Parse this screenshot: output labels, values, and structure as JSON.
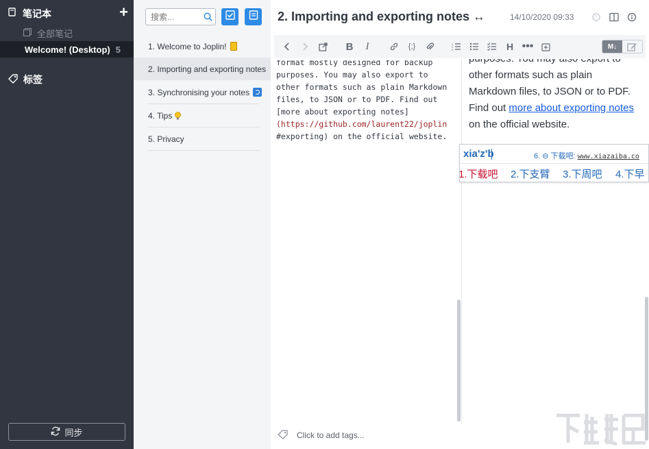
{
  "sidebar": {
    "notebooks_label": "笔记本",
    "add_label": "+",
    "all_notes_label": "全部笔记",
    "active_notebook": {
      "name": "Welcome! (Desktop)",
      "count": "5"
    },
    "tags_label": "标签",
    "sync_label": "同步"
  },
  "notelist": {
    "search_placeholder": "搜索...",
    "notes": [
      {
        "label": "1. Welcome to Joplin!",
        "emoji": "note"
      },
      {
        "label": "2. Importing and exporting notes",
        "emoji": ""
      },
      {
        "label": "3. Synchronising your notes",
        "emoji": "sync"
      },
      {
        "label": "4. Tips",
        "emoji": "bulb"
      },
      {
        "label": "5. Privacy",
        "emoji": ""
      }
    ]
  },
  "note": {
    "title": "2. Importing and exporting notes ↔",
    "date": "14/10/2020 09:33",
    "editor_lines": [
      "format mostly designed for backup",
      "purposes. You may also export to",
      "other formats such as plain Markdown",
      "files, to JSON or to PDF. Find out",
      "[more about exporting notes]",
      "(https://github.com/laurent22/joplin",
      "#exporting) on the official website."
    ],
    "viewer": {
      "line1": "purposes. You may also export to",
      "line2": "other formats such as plain",
      "line3": "Markdown files, to JSON or to PDF.",
      "line4_prefix": "Find out ",
      "link": "more about exporting notes",
      "line5": "on the official website."
    },
    "toolbar_toggle_label": "M↓",
    "tags_placeholder": "Click to add tags..."
  },
  "ime": {
    "composition": "xia'z'b",
    "hint_prefix": "6. ⊖ 下载吧: ",
    "hint_site": "www.xiazaiba.co",
    "candidates": [
      "1.下载吧",
      "2.下支臂",
      "3.下周吧",
      "4.下早"
    ]
  },
  "colors": {
    "sidebar_bg": "#313640",
    "accent_blue": "#2d8ae5",
    "link": "#155bda",
    "ime_blue": "#2469b8",
    "ime_first": "#c8102e"
  }
}
